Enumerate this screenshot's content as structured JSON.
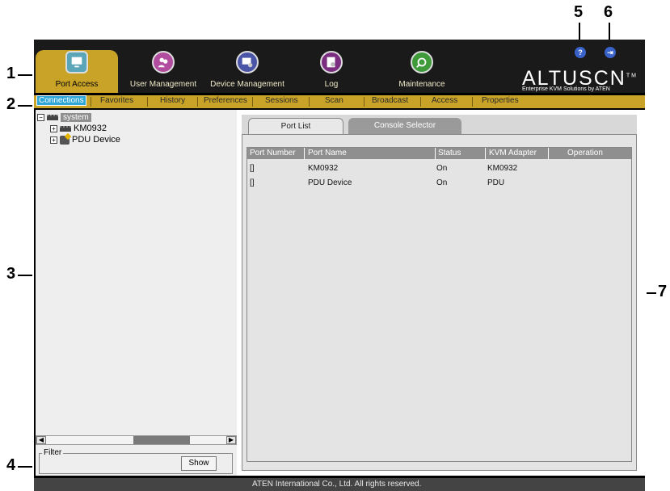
{
  "callouts": [
    "1",
    "2",
    "3",
    "4",
    "5",
    "6",
    "7"
  ],
  "topnav": {
    "items": [
      {
        "label": "Port Access",
        "icon": "port-access-icon",
        "color": "#5aa5b8"
      },
      {
        "label": "User Management",
        "icon": "user-management-icon",
        "color": "#b24c9e"
      },
      {
        "label": "Device Management",
        "icon": "device-management-icon",
        "color": "#4b55a8"
      },
      {
        "label": "Log",
        "icon": "log-icon",
        "color": "#7b2d7f"
      },
      {
        "label": "Maintenance",
        "icon": "maintenance-icon",
        "color": "#3f9a3a"
      }
    ],
    "help": "?",
    "logout": "⇥",
    "logo": "ALTUSCN",
    "logo_tm": "TM",
    "logo_sub": "Enterprise KVM Solutions by ATEN"
  },
  "menubar": {
    "items": [
      "Connections",
      "Favorites",
      "History",
      "Preferences",
      "Sessions",
      "Scan",
      "Broadcast",
      "Access",
      "Properties"
    ],
    "selected": "Connections"
  },
  "tree": {
    "root": "system",
    "children": [
      "KM0932",
      "PDU Device"
    ]
  },
  "filter": {
    "label": "Filter",
    "button": "Show"
  },
  "tabs": [
    "Port List",
    "Console Selector"
  ],
  "table": {
    "headers": [
      "Port Number",
      "Port Name",
      "Status",
      "KVM Adapter",
      "Operation"
    ],
    "rows": [
      [
        "[]",
        "KM0932",
        "On",
        "KM0932",
        ""
      ],
      [
        "[]",
        "PDU Device",
        "On",
        "PDU",
        ""
      ]
    ]
  },
  "statusbar": "ATEN International Co., Ltd. All rights reserved.",
  "colors": {
    "menubar": "#c8a327",
    "selected": "#2ea6d7",
    "header": "#8f8f8f"
  }
}
